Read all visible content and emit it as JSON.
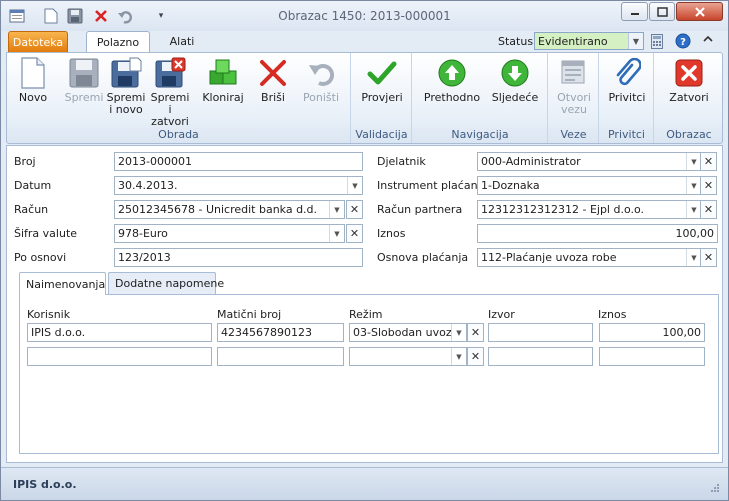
{
  "window": {
    "title": "Obrazac 1450: 2013-000001"
  },
  "ribbon_tabs": [
    "Datoteka",
    "Polazno",
    "Alati"
  ],
  "status": {
    "label": "Status",
    "value": "Evidentirano"
  },
  "ribbon": {
    "groups": [
      {
        "label": "Obrada",
        "buttons": [
          "Novo",
          "Spremi",
          "Spremi i novo",
          "Spremi i zatvori",
          "Kloniraj",
          "Briši",
          "Poništi"
        ]
      },
      {
        "label": "Validacija",
        "buttons": [
          "Provjeri"
        ]
      },
      {
        "label": "Navigacija",
        "buttons": [
          "Prethodno",
          "Sljedeće"
        ]
      },
      {
        "label": "Veze",
        "buttons": [
          "Otvori vezu"
        ]
      },
      {
        "label": "Privitci",
        "buttons": [
          "Privitci"
        ]
      },
      {
        "label": "Obrazac",
        "buttons": [
          "Zatvori"
        ]
      }
    ],
    "btn_novo": "Novo",
    "btn_spremi": "Spremi",
    "btn_spremi_novo_1": "Spremi",
    "btn_spremi_novo_2": "i novo",
    "btn_spremi_zatvori_1": "Spremi i",
    "btn_spremi_zatvori_2": "zatvori",
    "btn_kloniraj": "Kloniraj",
    "btn_brisi": "Briši",
    "btn_ponisti": "Poništi",
    "btn_provjeri": "Provjeri",
    "btn_prethodno": "Prethodno",
    "btn_sljedece": "Sljedeće",
    "btn_otvori_1": "Otvori",
    "btn_otvori_2": "vezu",
    "btn_privitci": "Privitci",
    "btn_zatvori": "Zatvori",
    "grp_obrada": "Obrada",
    "grp_validacija": "Validacija",
    "grp_navigacija": "Navigacija",
    "grp_veze": "Veze",
    "grp_privitci": "Privitci",
    "grp_obrazac": "Obrazac"
  },
  "form": {
    "broj_label": "Broj",
    "broj": "2013-000001",
    "datum_label": "Datum",
    "datum": "30.4.2013.",
    "racun_label": "Račun",
    "racun": "25012345678 - Unicredit banka d.d.",
    "sifra_label": "Šifra valute",
    "sifra": "978-Euro",
    "osnovi_label": "Po osnovi",
    "osnovi": "123/2013",
    "djelatnik_label": "Djelatnik",
    "djelatnik": "000-Administrator",
    "instrument_label": "Instrument plaćanja",
    "instrument": "1-Doznaka",
    "racun_partnera_label": "Račun partnera",
    "racun_partnera": "12312312312312 - Ejpl d.o.o.",
    "iznos_label": "Iznos",
    "iznos": "100,00",
    "osnova_label": "Osnova plaćanja",
    "osnova": "112-Plaćanje uvoza robe"
  },
  "subtabs": [
    "Naimenovanja",
    "Dodatne napomene"
  ],
  "grid": {
    "columns": [
      "Korisnik",
      "Matični broj",
      "Režim",
      "Izvor",
      "Iznos"
    ],
    "row1": {
      "korisnik": "IPIS d.o.o.",
      "maticni": "4234567890123",
      "rezim": "03-Slobodan uvoz",
      "izvor": "",
      "iznos": "100,00"
    }
  },
  "statusbar": {
    "company": "IPIS d.o.o."
  },
  "colors": {
    "status_bg": "#d5f0c3",
    "file_tab": "#f0a030",
    "accent": "#3f5a80"
  }
}
